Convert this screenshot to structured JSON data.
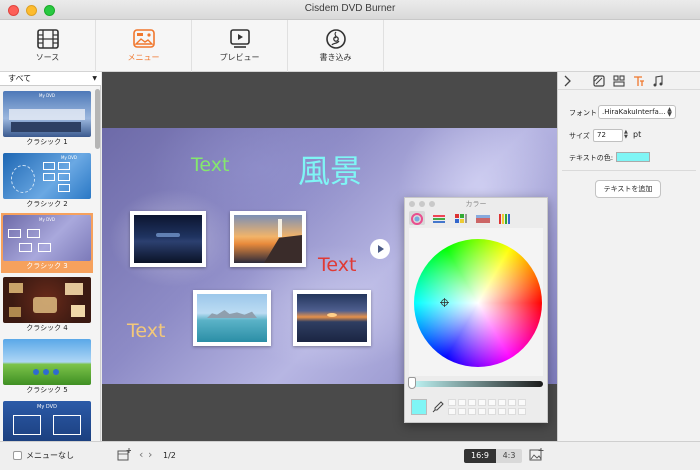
{
  "window": {
    "title": "Cisdem DVD Burner"
  },
  "toolbar": {
    "tabs": [
      {
        "label": "ソース",
        "icon": "film-icon"
      },
      {
        "label": "メニュー",
        "icon": "menu-image-icon",
        "active": true
      },
      {
        "label": "プレビュー",
        "icon": "play-icon"
      },
      {
        "label": "書き込み",
        "icon": "disc-burn-icon"
      }
    ],
    "accent_color": "#f0772d"
  },
  "sidebar": {
    "filter": "すべて",
    "templates": [
      {
        "label": "クラシック 1",
        "title": "My DVD"
      },
      {
        "label": "クラシック 2",
        "title": "My DVD"
      },
      {
        "label": "クラシック 3",
        "title": "My DVD",
        "selected": true
      },
      {
        "label": "クラシック 4"
      },
      {
        "label": "クラシック 5"
      },
      {
        "label": "",
        "title": "My DVD"
      }
    ]
  },
  "stage": {
    "title_text": "風景",
    "texts": [
      {
        "text": "Text",
        "color": "#84e86e"
      },
      {
        "text": "Text",
        "color": "#e03a35"
      },
      {
        "text": "Text",
        "color": "#f3c87a"
      }
    ],
    "title_color": "#7ff5f5"
  },
  "color_panel": {
    "title": "カラー",
    "selected_color": "#7ff5f5",
    "tabs": [
      "color-wheel-icon",
      "sliders-icon",
      "palette-icon",
      "image-palette-icon",
      "crayons-icon"
    ]
  },
  "inspector": {
    "tabs": [
      "chevron-right-icon",
      "background-icon",
      "layout-icon",
      "text-icon",
      "music-icon"
    ],
    "font_label": "フォント",
    "font_value": ".HiraKakuInterfa...",
    "size_label": "サイズ",
    "size_value": "72",
    "size_unit": "pt",
    "text_color_label": "テキストの色:",
    "text_color": "#7ff5f5",
    "add_text_button": "テキストを追加"
  },
  "bottombar": {
    "no_menu_label": "メニューなし",
    "no_menu_checked": false,
    "page": "1/2",
    "ratio_169": "16:9",
    "ratio_43": "4:3",
    "ratio_selected": "16:9"
  }
}
